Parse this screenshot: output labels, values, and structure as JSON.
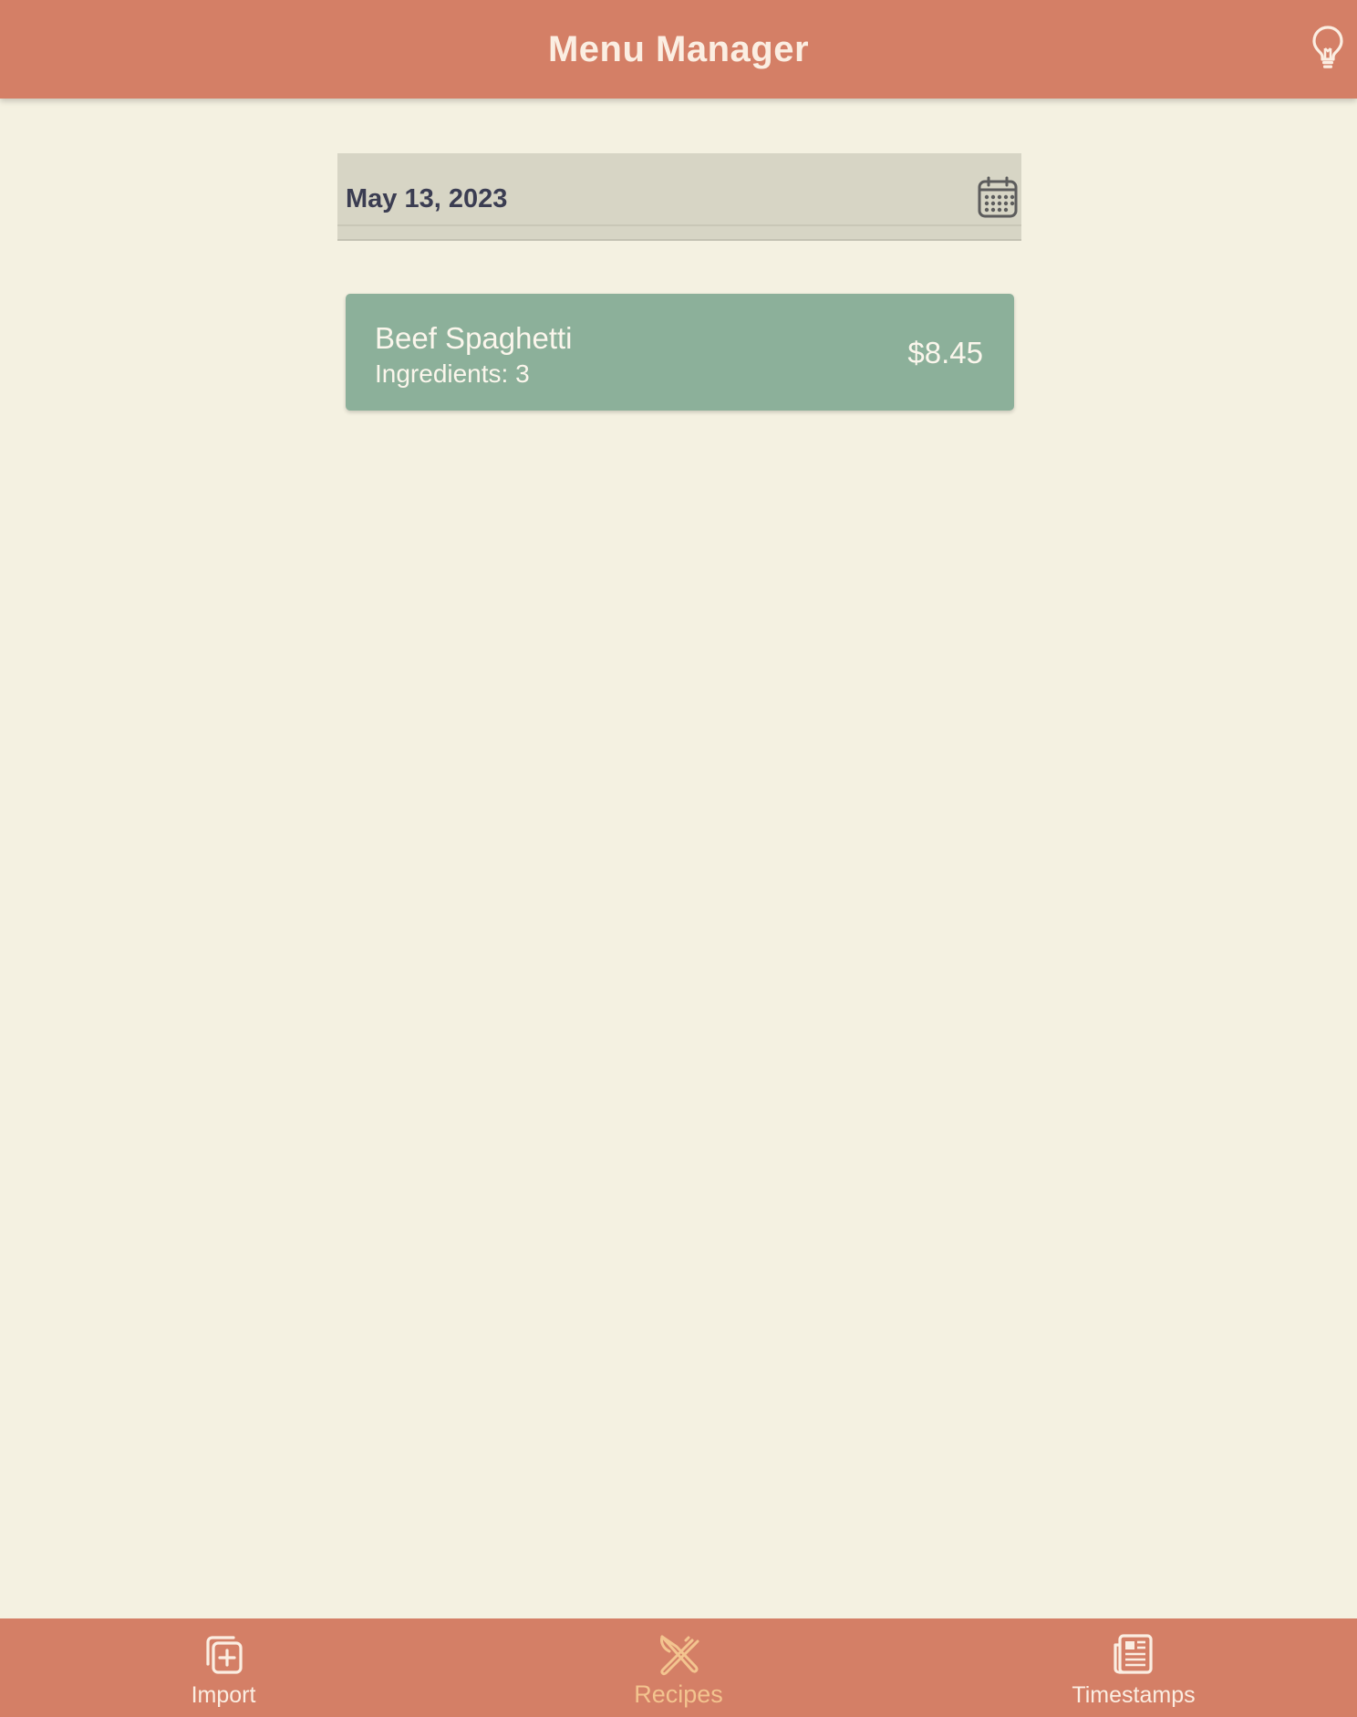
{
  "header": {
    "title": "Menu Manager",
    "bulb_icon": "lightbulb-icon"
  },
  "date_picker": {
    "value": "May 13, 2023",
    "icon": "calendar-icon"
  },
  "recipes": [
    {
      "name": "Beef Spaghetti",
      "ingredients": "Ingredients: 3",
      "price": "$8.45"
    }
  ],
  "bottom_nav": {
    "items": [
      {
        "label": "Import",
        "icon": "import-add-icon",
        "active": false
      },
      {
        "label": "Recipes",
        "icon": "fork-knife-icon",
        "active": true
      },
      {
        "label": "Timestamps",
        "icon": "newspaper-icon",
        "active": false
      }
    ]
  },
  "colors": {
    "primary": "#d47f66",
    "background": "#f4f1e1",
    "card": "#8cb09a",
    "active_nav": "#f3c48f",
    "text_light": "#fbeee2",
    "text_dark": "#3b3d52"
  }
}
